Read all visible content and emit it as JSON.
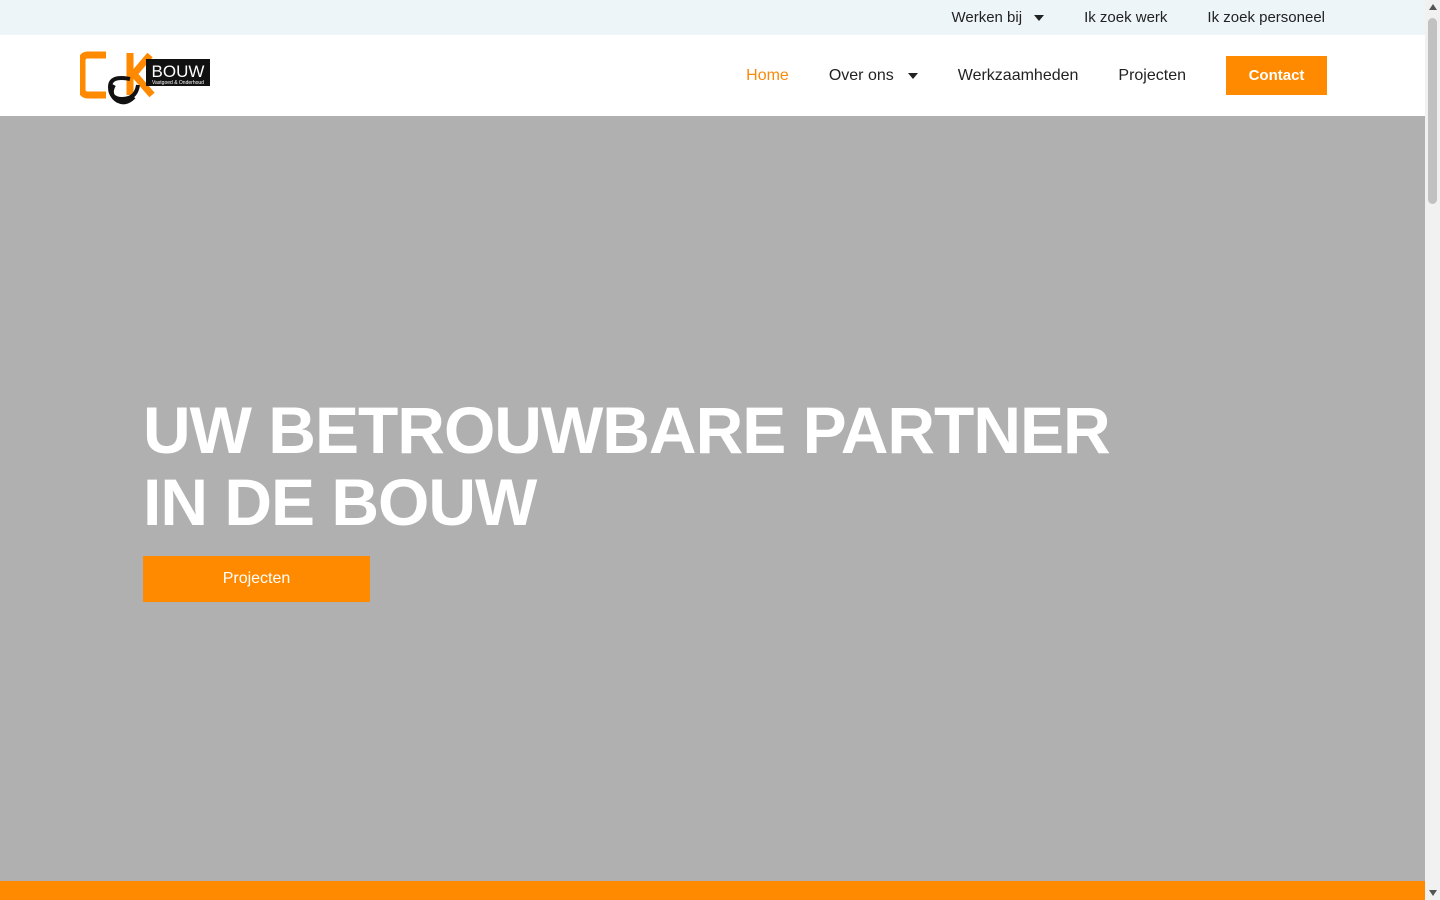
{
  "colors": {
    "accent": "#ff8a00",
    "topbar_bg": "#eef5f9",
    "hero_bg": "#b0b0b0"
  },
  "topbar": {
    "items": [
      {
        "label": "Werken bij",
        "has_dropdown": true
      },
      {
        "label": "Ik zoek werk"
      },
      {
        "label": "Ik zoek personeel"
      }
    ]
  },
  "header": {
    "logo": {
      "letters": "C&K",
      "brand": "BOUW",
      "tagline": "Vastgoed & Onderhoud"
    },
    "nav": [
      {
        "label": "Home",
        "active": true
      },
      {
        "label": "Over ons",
        "has_dropdown": true
      },
      {
        "label": "Werkzaamheden"
      },
      {
        "label": "Projecten"
      }
    ],
    "contact_label": "Contact"
  },
  "hero": {
    "title_line1": "UW BETROUWBARE PARTNER",
    "title_line2": "IN DE BOUW",
    "cta_label": "Projecten"
  }
}
